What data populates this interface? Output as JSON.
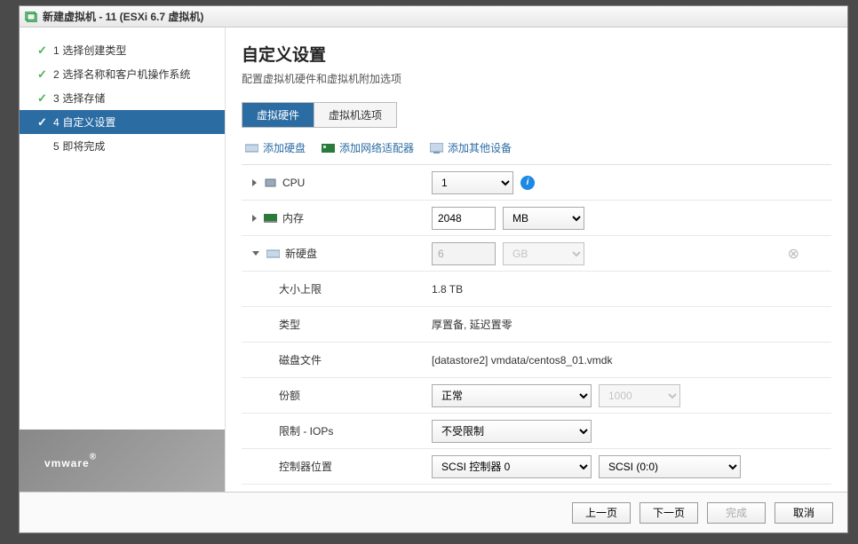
{
  "title": "新建虚拟机 - 11 (ESXi 6.7 虚拟机)",
  "steps": [
    {
      "num": "1",
      "label": "选择创建类型",
      "state": "done"
    },
    {
      "num": "2",
      "label": "选择名称和客户机操作系统",
      "state": "done"
    },
    {
      "num": "3",
      "label": "选择存储",
      "state": "done"
    },
    {
      "num": "4",
      "label": "自定义设置",
      "state": "current"
    },
    {
      "num": "5",
      "label": "即将完成",
      "state": "future"
    }
  ],
  "brand": "vmware",
  "page": {
    "title": "自定义设置",
    "sub": "配置虚拟机硬件和虚拟机附加选项"
  },
  "tabs": {
    "hw": "虚拟硬件",
    "opts": "虚拟机选项",
    "active": 0
  },
  "add": {
    "disk": "添加硬盘",
    "nic": "添加网络适配器",
    "other": "添加其他设备"
  },
  "hw": {
    "cpu": {
      "label": "CPU",
      "value": "1"
    },
    "mem": {
      "label": "内存",
      "value": "2048",
      "unit": "MB"
    },
    "disk": {
      "label": "新硬盘",
      "size": "6",
      "unit": "GB",
      "max_label": "大小上限",
      "max_value": "1.8 TB",
      "type_label": "类型",
      "type_value": "厚置备, 延迟置零",
      "file_label": "磁盘文件",
      "file_value": "[datastore2] vmdata/centos8_01.vmdk",
      "shares_label": "份额",
      "shares_value": "正常",
      "shares_num": "1000",
      "limit_label": "限制 - IOPs",
      "limit_value": "不受限制",
      "ctrl_label": "控制器位置",
      "ctrl_value": "SCSI 控制器 0",
      "ctrl_pos": "SCSI (0:0)"
    }
  },
  "footer": {
    "prev": "上一页",
    "next": "下一页",
    "finish": "完成",
    "cancel": "取消"
  }
}
